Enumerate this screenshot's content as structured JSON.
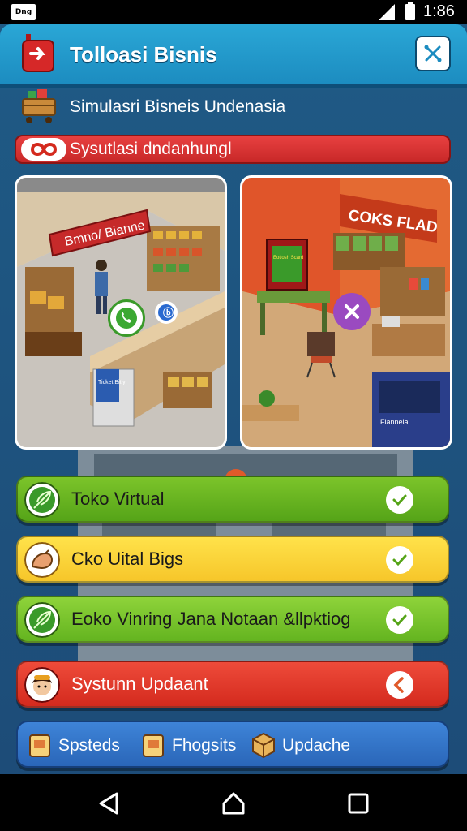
{
  "status_bar": {
    "time": "1:86",
    "app_icon_label": "Dng"
  },
  "header": {
    "title": "Tolloasi Bisnis"
  },
  "subheader": {
    "text": "Simulasri Bisneis Undenasia"
  },
  "banner": {
    "text": "Sysutlasi dndanhungl"
  },
  "scene_left": {
    "sign": "Bmno/ Bianne",
    "kiosk": "Ticket Bitly"
  },
  "scene_right": {
    "sign": "COKS FLAD",
    "poster": "Eotlosh Scard",
    "kiosk": "Flannela"
  },
  "menu": [
    {
      "label": "Toko Virtual",
      "icon": "leaf-icon",
      "status": "check"
    },
    {
      "label": "Cko Uital Bigs",
      "icon": "moneybag-icon",
      "status": "check"
    },
    {
      "label": "Eoko Vinring Jana Notaan &llpktiog",
      "icon": "leaf-icon",
      "status": "check"
    },
    {
      "label": "Systunn Updaant",
      "icon": "avatar-icon",
      "status": "warning"
    }
  ],
  "bottom_nav": [
    {
      "label": "Spsteds",
      "icon": "box-icon"
    },
    {
      "label": "Fhogsits",
      "icon": "box-icon"
    },
    {
      "label": "Updache",
      "icon": "box-icon"
    }
  ],
  "colors": {
    "header": "#1c8cc0",
    "banner": "#d42a1e",
    "green": "#55a418",
    "yellow": "#f6c62a",
    "red": "#d42a1e",
    "blue": "#2a66b8"
  }
}
